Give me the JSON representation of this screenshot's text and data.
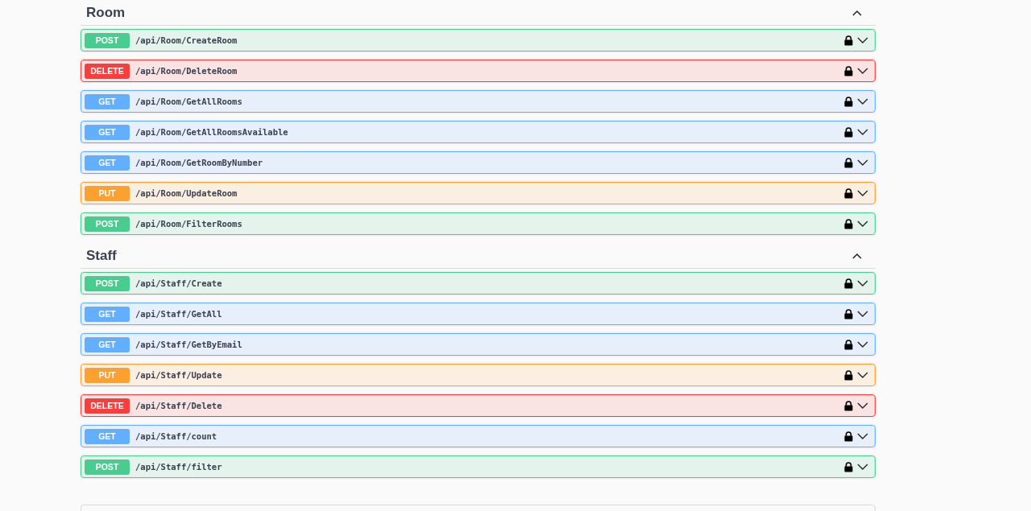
{
  "sections": [
    {
      "name": "Room",
      "expanded": true,
      "operations": [
        {
          "kind": "post",
          "method": "POST",
          "path": "/api/Room/CreateRoom"
        },
        {
          "kind": "delete",
          "method": "DELETE",
          "path": "/api/Room/DeleteRoom"
        },
        {
          "kind": "get",
          "method": "GET",
          "path": "/api/Room/GetAllRooms"
        },
        {
          "kind": "get",
          "method": "GET",
          "path": "/api/Room/GetAllRoomsAvailable"
        },
        {
          "kind": "get",
          "method": "GET",
          "path": "/api/Room/GetRoomByNumber"
        },
        {
          "kind": "put",
          "method": "PUT",
          "path": "/api/Room/UpdateRoom"
        },
        {
          "kind": "post",
          "method": "POST",
          "path": "/api/Room/FilterRooms"
        }
      ]
    },
    {
      "name": "Staff",
      "expanded": true,
      "operations": [
        {
          "kind": "post",
          "method": "POST",
          "path": "/api/Staff/Create"
        },
        {
          "kind": "get",
          "method": "GET",
          "path": "/api/Staff/GetAll"
        },
        {
          "kind": "get",
          "method": "GET",
          "path": "/api/Staff/GetByEmail"
        },
        {
          "kind": "put",
          "method": "PUT",
          "path": "/api/Staff/Update"
        },
        {
          "kind": "delete",
          "method": "DELETE",
          "path": "/api/Staff/Delete"
        },
        {
          "kind": "get",
          "method": "GET",
          "path": "/api/Staff/count"
        },
        {
          "kind": "post",
          "method": "POST",
          "path": "/api/Staff/filter"
        }
      ]
    }
  ]
}
